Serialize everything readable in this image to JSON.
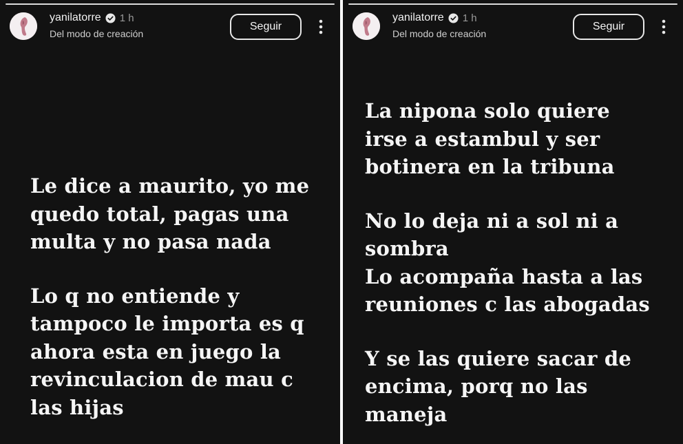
{
  "stories": [
    {
      "username": "yanilatorre",
      "time": "1 h",
      "subtitle": "Del modo de creación",
      "follow_label": "Seguir",
      "paragraphs": [
        "Le dice a maurito, yo me\nquedo total, pagas una\nmulta y no pasa nada",
        "Lo q no entiende y\ntampoco le importa es q\nahora esta en juego la\nrevinculacion de mau c\nlas hijas"
      ]
    },
    {
      "username": "yanilatorre",
      "time": "1 h",
      "subtitle": "Del modo de creación",
      "follow_label": "Seguir",
      "paragraphs": [
        "La nipona solo quiere\nirse a estambul y ser\nbotinera en la tribuna",
        "No lo deja ni a sol ni a\nsombra",
        "Lo acompaña hasta a las\nreuniones c las abogadas",
        "Y se las quiere sacar de\nencima, porq no las\nmaneja"
      ]
    }
  ],
  "icons": {
    "verified": "verified-badge-icon",
    "more": "more-options-icon",
    "avatar": "profile-avatar"
  },
  "colors": {
    "background": "#121212",
    "text": "#f5f5f5",
    "muted": "#9a9a9a"
  }
}
